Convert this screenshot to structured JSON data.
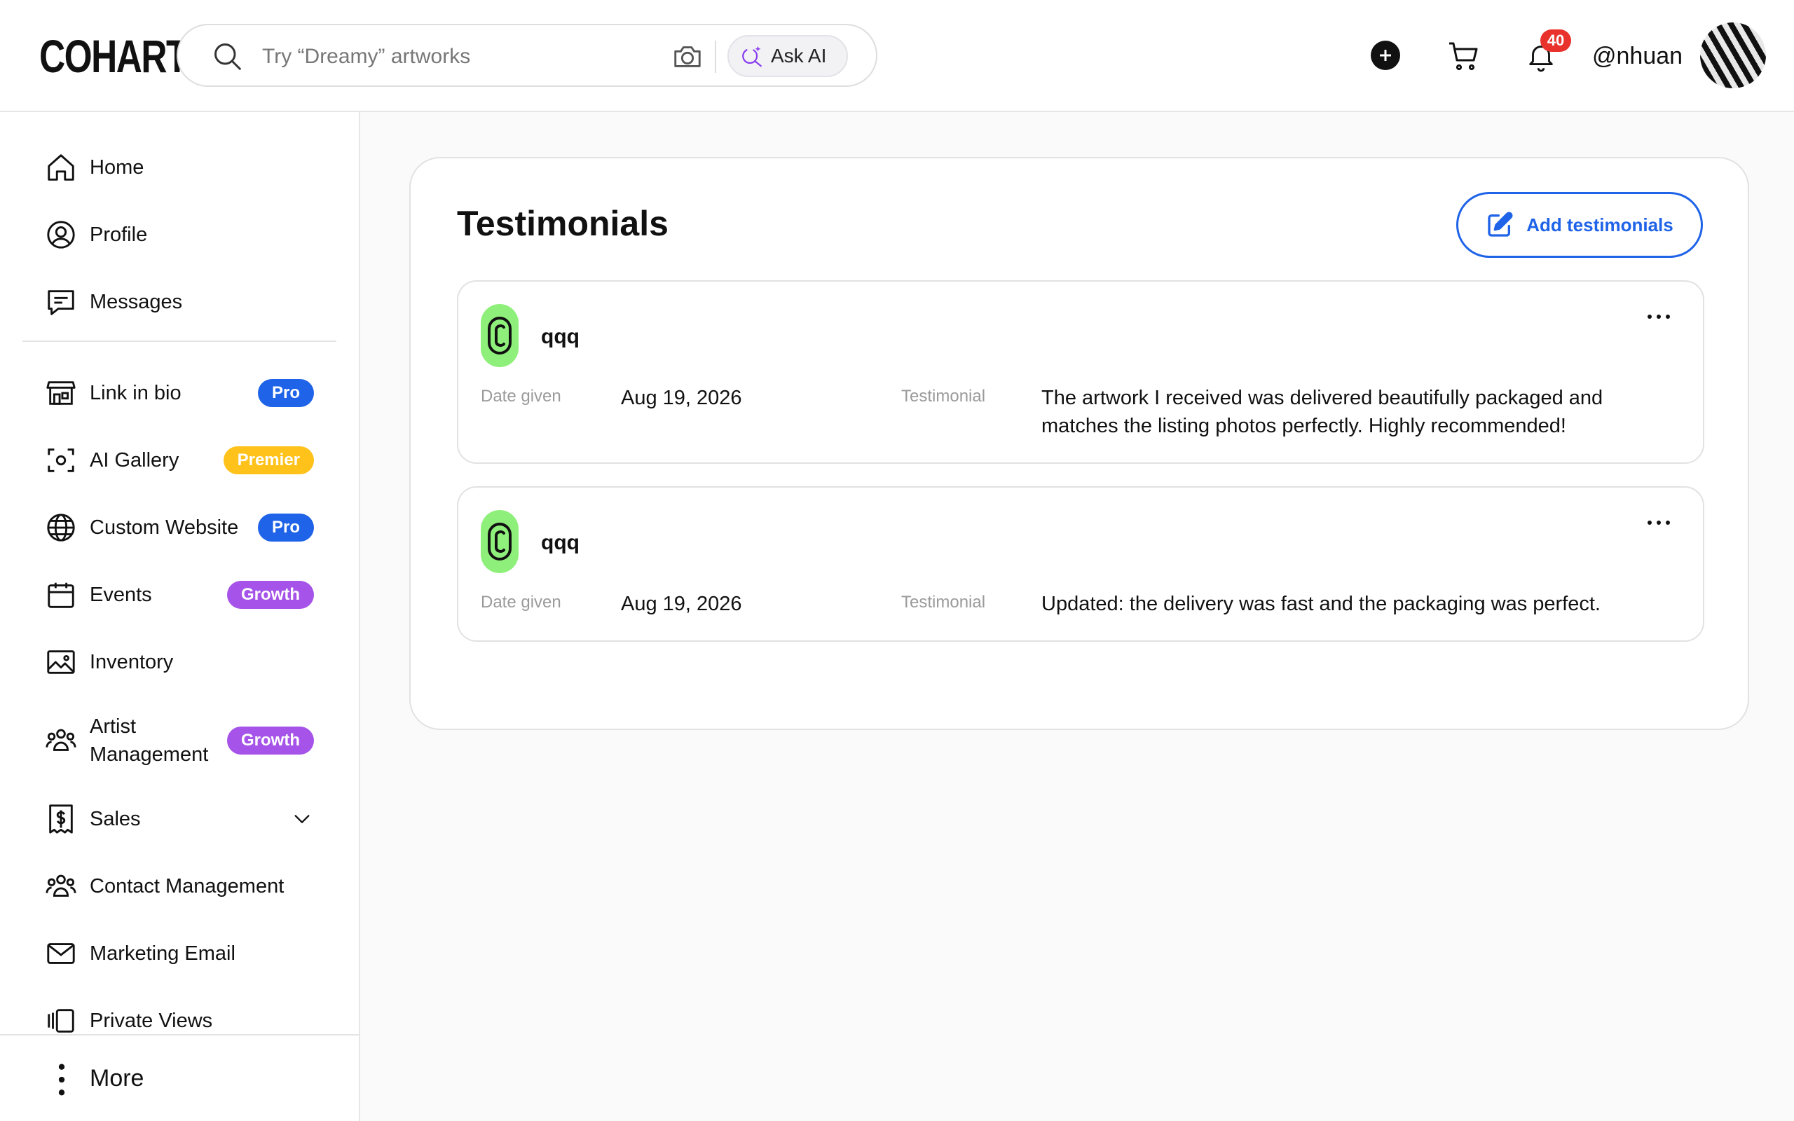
{
  "header": {
    "logo": "COHART",
    "search_placeholder": "Try “Dreamy” artworks",
    "ask_ai_label": "Ask AI",
    "notifications_count": "40",
    "username": "@nhuan"
  },
  "sidebar": {
    "items": [
      {
        "label": "Home",
        "icon": "home-icon"
      },
      {
        "label": "Profile",
        "icon": "user-circle-icon"
      },
      {
        "label": "Messages",
        "icon": "message-icon"
      },
      {
        "label": "Link in bio",
        "icon": "store-icon",
        "badge": "Pro"
      },
      {
        "label": "AI Gallery",
        "icon": "scan-face-icon",
        "badge": "Premier"
      },
      {
        "label": "Custom Website",
        "icon": "globe-icon",
        "badge": "Pro"
      },
      {
        "label": "Events",
        "icon": "calendar-icon",
        "badge": "Growth"
      },
      {
        "label": "Inventory",
        "icon": "image-icon"
      },
      {
        "label": "Artist Management",
        "icon": "users-icon",
        "badge": "Growth"
      },
      {
        "label": "Sales",
        "icon": "dollar-receipt-icon"
      },
      {
        "label": "Contact Management",
        "icon": "users-icon"
      },
      {
        "label": "Marketing Email",
        "icon": "mail-icon"
      },
      {
        "label": "Private Views",
        "icon": "gallery-icon"
      }
    ],
    "more_label": "More"
  },
  "main": {
    "title": "Testimonials",
    "add_button_label": "Add testimonials",
    "date_label": "Date given",
    "testimonial_label": "Testimonial",
    "testimonials": [
      {
        "name": "qqq",
        "date": "Aug 19, 2026",
        "text": "The artwork I received was delivered beautifully packaged and matches the listing photos perfectly. Highly recommended!"
      },
      {
        "name": "qqq",
        "date": "Aug 19, 2026",
        "text": "Updated: the delivery was fast and the packaging was perfect."
      }
    ]
  },
  "colors": {
    "accent_blue": "#1e63e8",
    "premier_yellow": "#ffc21a",
    "growth_purple": "#a553e8",
    "logo_green": "#8ef07a",
    "badge_red": "#e8322b"
  }
}
